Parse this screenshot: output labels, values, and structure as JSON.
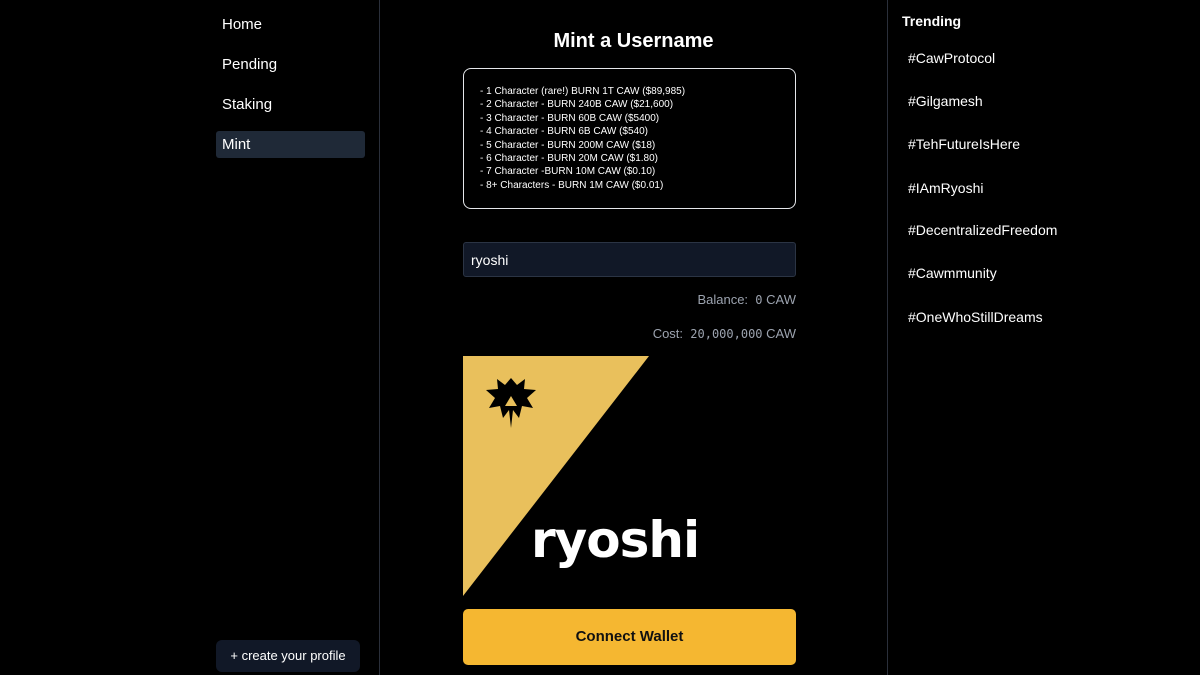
{
  "nav": {
    "items": [
      {
        "label": "Home"
      },
      {
        "label": "Pending"
      },
      {
        "label": "Staking"
      },
      {
        "label": "Mint"
      }
    ],
    "active": "Mint",
    "create_profile_label": "+ create your profile"
  },
  "main": {
    "title": "Mint a Username",
    "pricing": [
      "- 1 Character (rare!) BURN 1T CAW ($89,985)",
      "- 2 Character - BURN 240B CAW ($21,600)",
      "- 3 Character - BURN 60B CAW ($5400)",
      "- 4 Character - BURN 6B CAW ($540)",
      "- 5 Character - BURN 200M CAW ($18)",
      "- 6 Character - BURN 20M CAW ($1.80)",
      "- 7 Character -BURN 10M CAW ($0.10)",
      "- 8+ Characters - BURN 1M CAW ($0.01)"
    ],
    "username_value": "ryoshi",
    "balance_label": "Balance:",
    "balance_value": "0",
    "balance_unit": "CAW",
    "cost_label": "Cost:",
    "cost_value": "20,000,000",
    "cost_unit": "CAW",
    "preview_name": "ryoshi",
    "preview_icon": "caw-logo-icon",
    "connect_label": "Connect Wallet"
  },
  "trending": {
    "title": "Trending",
    "tags": [
      "#CawProtocol",
      "#Gilgamesh",
      "#TehFutureIsHere",
      "#IAmRyoshi",
      "#DecentralizedFreedom",
      "#Cawmmunity",
      "#OneWhoStillDreams"
    ]
  },
  "colors": {
    "accent": "#f5b731",
    "card_gold": "#e9c05c",
    "panel": "#111827",
    "nav_active": "#1f2937"
  }
}
